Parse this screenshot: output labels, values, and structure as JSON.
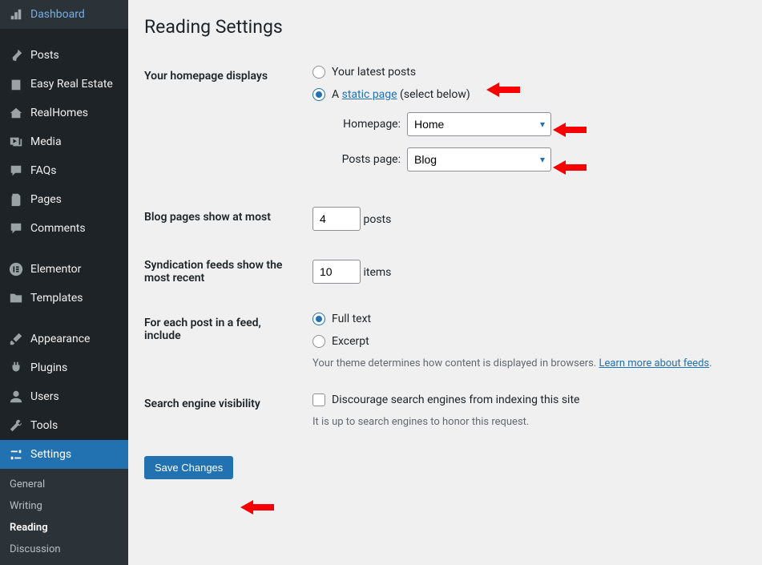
{
  "sidebar": {
    "items": [
      {
        "label": "Dashboard"
      },
      {
        "label": "Posts"
      },
      {
        "label": "Easy Real Estate"
      },
      {
        "label": "RealHomes"
      },
      {
        "label": "Media"
      },
      {
        "label": "FAQs"
      },
      {
        "label": "Pages"
      },
      {
        "label": "Comments"
      },
      {
        "label": "Elementor"
      },
      {
        "label": "Templates"
      },
      {
        "label": "Appearance"
      },
      {
        "label": "Plugins"
      },
      {
        "label": "Users"
      },
      {
        "label": "Tools"
      },
      {
        "label": "Settings"
      }
    ],
    "submenu": {
      "items": [
        {
          "label": "General"
        },
        {
          "label": "Writing"
        },
        {
          "label": "Reading"
        },
        {
          "label": "Discussion"
        }
      ]
    }
  },
  "page": {
    "title": "Reading Settings",
    "homepage_displays": {
      "label": "Your homepage displays",
      "option_latest": "Your latest posts",
      "option_static_prefix": "A ",
      "option_static_link": "static page",
      "option_static_suffix": " (select below)",
      "homepage_label": "Homepage:",
      "homepage_value": "Home",
      "postspage_label": "Posts page:",
      "postspage_value": "Blog"
    },
    "blog_pages": {
      "label": "Blog pages show at most",
      "value": "4",
      "suffix": "posts"
    },
    "syndication": {
      "label": "Syndication feeds show the most recent",
      "value": "10",
      "suffix": "items"
    },
    "feed_include": {
      "label": "For each post in a feed, include",
      "option_full": "Full text",
      "option_excerpt": "Excerpt",
      "desc_prefix": "Your theme determines how content is displayed in browsers. ",
      "desc_link": "Learn more about feeds",
      "desc_suffix": "."
    },
    "search_visibility": {
      "label": "Search engine visibility",
      "checkbox_label": "Discourage search engines from indexing this site",
      "desc": "It is up to search engines to honor this request."
    },
    "save_button": "Save Changes"
  }
}
